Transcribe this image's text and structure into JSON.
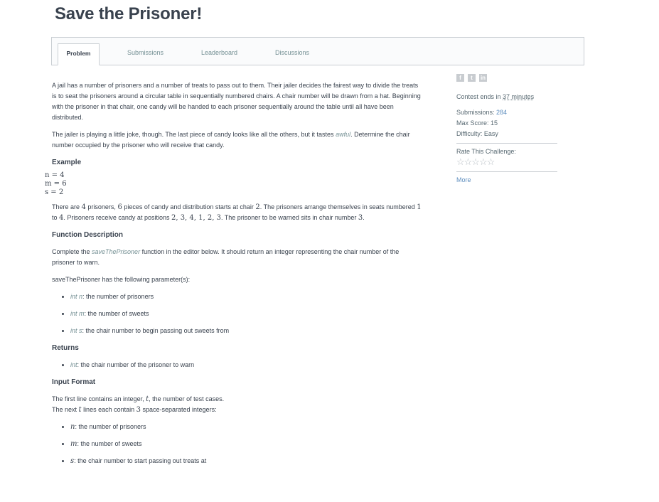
{
  "title": "Save the Prisoner!",
  "tabs": [
    {
      "label": "Problem"
    },
    {
      "label": "Submissions"
    },
    {
      "label": "Leaderboard"
    },
    {
      "label": "Discussions"
    }
  ],
  "problem": {
    "intro": "A jail has a number of prisoners and a number of treats to pass out to them. Their jailer decides the fairest way to divide the treats is to seat the prisoners around a circular table in sequentially numbered chairs. A chair number will be drawn from a hat. Beginning with the prisoner in that chair, one candy will be handed to each prisoner sequentially around the table until all have been distributed.",
    "joke_a": "The jailer is playing a little joke, though. The last piece of candy looks like all the others, but it tastes ",
    "joke_em": "awful",
    "joke_b": ". Determine the chair number occupied by the prisoner who will receive that candy.",
    "example_heading": "Example",
    "example_lines": [
      "n = 4",
      "m = 6",
      "s = 2"
    ],
    "example_desc": {
      "p1": "There are ",
      "n": "4",
      "p2": " prisoners, ",
      "m": "6",
      "p3": " pieces of candy and distribution starts at chair ",
      "s": "2",
      "p4": ". The prisoners arrange themselves in seats numbered ",
      "one": "1",
      "p5": " to ",
      "four": "4",
      "p6": ". Prisoners receive candy at positions ",
      "positions": "2, 3, 4, 1, 2, 3",
      "p7": ". The prisoner to be warned sits in chair number ",
      "ans": "3",
      "p8": "."
    },
    "func_heading": "Function Description",
    "func_a": "Complete the ",
    "func_em": "saveThePrisoner",
    "func_b": " function in the editor below. It should return an integer representing the chair number of the prisoner to warn.",
    "params_intro": "saveThePrisoner has the following parameter(s):",
    "params": [
      {
        "type": "int n",
        "desc": ": the number of prisoners"
      },
      {
        "type": "int m",
        "desc": ": the number of sweets"
      },
      {
        "type": "int s",
        "desc": ": the chair number to begin passing out sweets from"
      }
    ],
    "returns_heading": "Returns",
    "returns": {
      "type": "int",
      "desc": ": the chair number of the prisoner to warn"
    },
    "input_heading": "Input Format",
    "input_a": "The first line contains an integer, ",
    "input_t": "t",
    "input_b": ", the number of test cases.",
    "input_c": "The next ",
    "input_t2": "t",
    "input_d": " lines each contain ",
    "input_3": "3",
    "input_e": " space-separated integers:",
    "input_items": [
      {
        "var": "n",
        "desc": ": the number of prisoners"
      },
      {
        "var": "m",
        "desc": ": the number of sweets"
      },
      {
        "var": "s",
        "desc": ": the chair number to start passing out treats at"
      }
    ]
  },
  "sidebar": {
    "share_icons": [
      "f",
      "t",
      "in"
    ],
    "contest_prefix": "Contest ends in ",
    "contest_time": "37 minutes",
    "submissions_label": "Submissions: ",
    "submissions_value": "284",
    "max_score_label": "Max Score: ",
    "max_score_value": "15",
    "difficulty_label": "Difficulty: ",
    "difficulty_value": "Easy",
    "rate_label": "Rate This Challenge:",
    "stars": "☆☆☆☆☆",
    "more_label": "More"
  }
}
